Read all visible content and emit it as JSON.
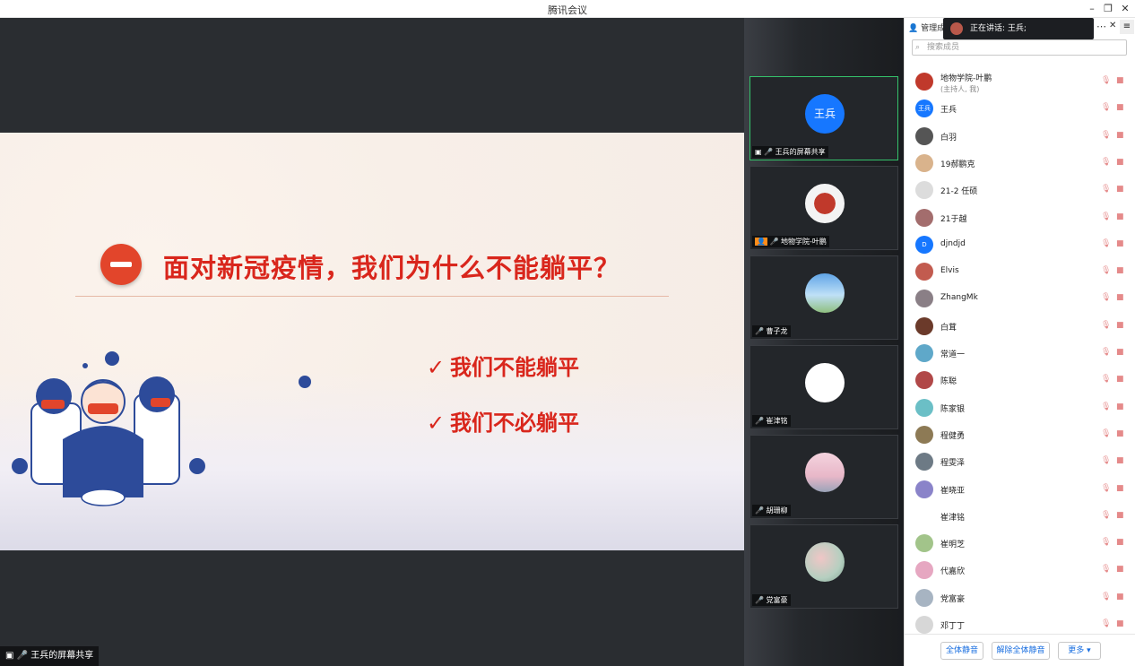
{
  "window": {
    "title": "腾讯会议"
  },
  "slide": {
    "title": "面对新冠疫情，我们为什么不能躺平？",
    "points": [
      "我们不能躺平",
      "我们不必躺平"
    ],
    "check": "✓"
  },
  "main_share_label": "王兵的屏幕共享",
  "tiles": [
    {
      "name": "王兵的屏幕共享",
      "avatar_text": "王兵",
      "avatar_color": "#1677ff"
    },
    {
      "name": "地物学院-叶鹏",
      "avatar_color": "#c0392b"
    },
    {
      "name": "曹子龙",
      "avatar_color": "#7fb5e6"
    },
    {
      "name": "崔津铭",
      "avatar_color": "#ffffff"
    },
    {
      "name": "胡珊柳",
      "avatar_color": "#e8b7c8"
    },
    {
      "name": "党富豪",
      "avatar_color": "#b5cfc0"
    }
  ],
  "toast": {
    "text": "正在讲话: 王兵;"
  },
  "panel": {
    "header": "管理成",
    "search_placeholder": "搜索成员",
    "members": [
      {
        "name": "地物学院-叶鹏",
        "sub": "(主持人, 我)",
        "color": "#c0392b"
      },
      {
        "name": "王兵",
        "avatar_text": "王兵",
        "color": "#1677ff"
      },
      {
        "name": "白羽",
        "color": "#555555"
      },
      {
        "name": "19郝鹏克",
        "color": "#d9b38c"
      },
      {
        "name": "21-2 任硕",
        "color": "#dcdcdc"
      },
      {
        "name": "21于越",
        "color": "#a36d6d"
      },
      {
        "name": "djndjd",
        "avatar_text": "D",
        "color": "#1677ff"
      },
      {
        "name": "Elvis",
        "color": "#c25b4f"
      },
      {
        "name": "ZhangMk",
        "color": "#8a7f86"
      },
      {
        "name": "白茸",
        "color": "#6b3a2a"
      },
      {
        "name": "常道一",
        "color": "#5fa8c9"
      },
      {
        "name": "陈聪",
        "color": "#b14848"
      },
      {
        "name": "陈家银",
        "color": "#6bbfc6"
      },
      {
        "name": "程健勇",
        "color": "#8d7a55"
      },
      {
        "name": "程雯泽",
        "color": "#6d7a85"
      },
      {
        "name": "崔晓亚",
        "color": "#8a83c9"
      },
      {
        "name": "崔津铭",
        "color": "#ffffff"
      },
      {
        "name": "崔明芝",
        "color": "#a2c48a"
      },
      {
        "name": "代嘉欣",
        "color": "#e6a7c1"
      },
      {
        "name": "党富豪",
        "color": "#a7b4c2"
      },
      {
        "name": "邓丁丁",
        "color": "#d7d7d7"
      }
    ],
    "buttons": {
      "mute_all": "全体静音",
      "unmute_all": "解除全体静音",
      "more": "更多 ▾"
    }
  }
}
